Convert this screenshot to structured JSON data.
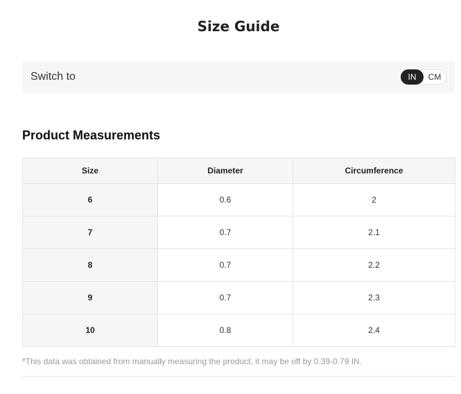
{
  "title": "Size Guide",
  "unit_switch": {
    "label": "Switch to",
    "options": [
      "IN",
      "CM"
    ],
    "selected": "IN"
  },
  "section_title": "Product Measurements",
  "table": {
    "headers": [
      "Size",
      "Diameter",
      "Circumference"
    ],
    "rows": [
      [
        "6",
        "0.6",
        "2"
      ],
      [
        "7",
        "0.7",
        "2.1"
      ],
      [
        "8",
        "0.7",
        "2.2"
      ],
      [
        "9",
        "0.7",
        "2.3"
      ],
      [
        "10",
        "0.8",
        "2.4"
      ]
    ]
  },
  "note": "*This data was obtained from manually measuring the product, it may be off by 0.39-0.79 IN.",
  "colors": {
    "toggle_active_bg": "#222222",
    "panel_bg": "#f6f6f6",
    "border": "#e5e5e5",
    "note_text": "#999999"
  }
}
